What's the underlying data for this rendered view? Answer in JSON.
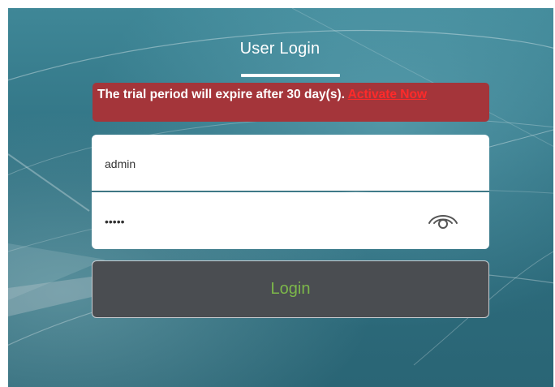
{
  "header": {
    "tab_label": "User Login"
  },
  "notice": {
    "message": "The trial period will expire after 30 day(s). ",
    "link_label": "Activate Now"
  },
  "form": {
    "username_value": "admin",
    "password_value": "•••••",
    "show_password_icon": "eye-icon",
    "login_label": "Login"
  },
  "colors": {
    "background": "#2e6f80",
    "notice_bg": "#a4353a",
    "notice_link": "#ff2a2a",
    "button_bg": "#4a4d51",
    "button_text": "#7db84a"
  }
}
